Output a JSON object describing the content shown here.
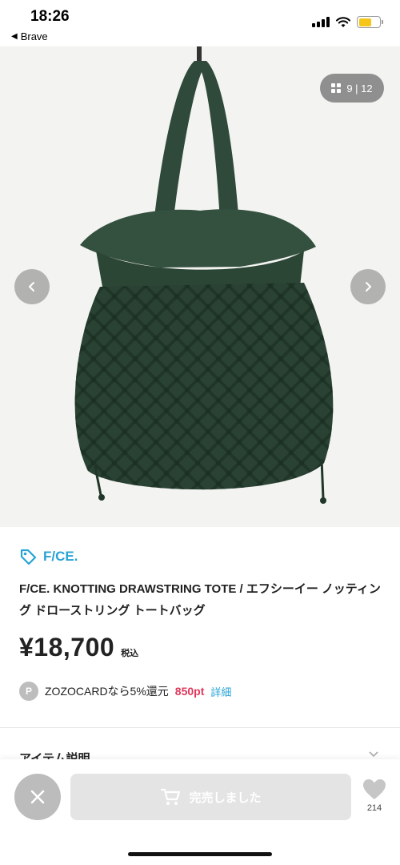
{
  "status_bar": {
    "time": "18:26",
    "back_app": "Brave",
    "battery_color": "#f5c518"
  },
  "gallery": {
    "counter": "9 | 12",
    "prev_icon": "chevron-left-icon",
    "next_icon": "chevron-right-icon",
    "image_subject": "green knotted net drawstring tote bag"
  },
  "product": {
    "brand": "F/CE.",
    "title": "F/CE. KNOTTING DRAWSTRING TOTE / エフシーイー ノッティング ドローストリング トートバッグ",
    "price": "¥18,700",
    "tax_label": "税込"
  },
  "points": {
    "badge": "P",
    "text": "ZOZOCARDなら5%還元",
    "amount": "850pt",
    "detail_link": "詳細"
  },
  "section": {
    "title": "アイテム説明"
  },
  "bottom_bar": {
    "soldout_label": "完売しました",
    "favorite_count": "214"
  },
  "colors": {
    "accent": "#29a3d6",
    "points": "#e0385b",
    "bag": "#2f4a3a"
  }
}
